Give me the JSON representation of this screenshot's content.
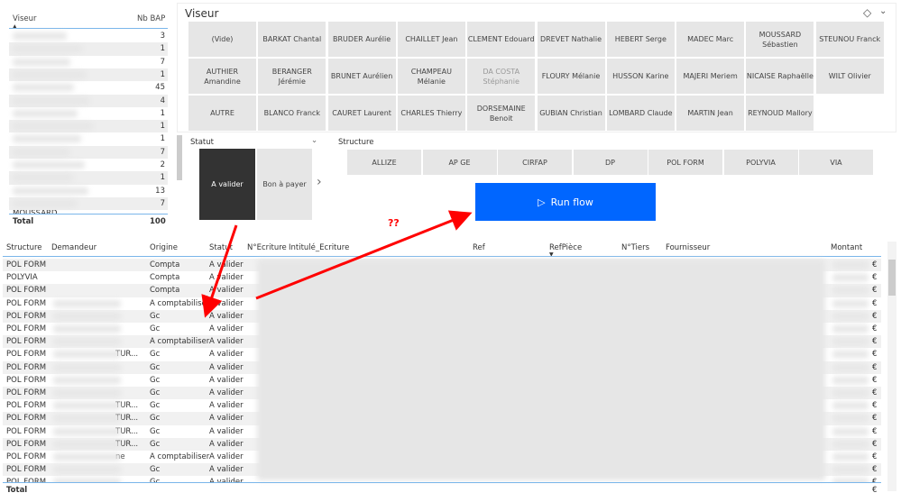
{
  "left_table": {
    "col_viseur": "Viseur",
    "col_nb": "Nb BAP",
    "values": [
      "3",
      "1",
      "7",
      "1",
      "45",
      "4",
      "1",
      "1",
      "1",
      "7",
      "2",
      "1",
      "13",
      "7"
    ],
    "partial_row": "MOUSSARD Sébastien",
    "total_label": "Total",
    "total_value": "100"
  },
  "viseur_slicer": {
    "title": "Viseur",
    "items": [
      "(Vide)",
      "BARKAT Chantal",
      "BRUDER Aurélie",
      "CHAILLET Jean",
      "CLEMENT Edouard",
      "DREVET Nathalie",
      "HEBERT Serge",
      "MADEC Marc",
      "MOUSSARD Sébastien",
      "STEUNOU Franck",
      "AUTHIER Amandine",
      "BERANGER Jérémie",
      "BRUNET Aurélien",
      "CHAMPEAU Mélanie",
      "DA COSTA Stéphanie",
      "FLOURY Mélanie",
      "HUSSON Karine",
      "MAJERI Meriem",
      "NICAISE Raphaëlle",
      "WILT Olivier",
      "AUTRE",
      "BLANCO Franck",
      "CAURET Laurent",
      "CHARLES Thierry",
      "DORSEMAINE Benoit",
      "GUBIAN Christian",
      "LOMBARD Claude",
      "MARTIN Jean",
      "REYNOUD Mallory"
    ]
  },
  "statut_slicer": {
    "title": "Statut",
    "items": [
      "A valider",
      "Bon à payer"
    ],
    "selected": "A valider"
  },
  "structure_slicer": {
    "title": "Structure",
    "items": [
      "ALLIZE",
      "AP GE",
      "CIRFAP",
      "DP",
      "POL FORM",
      "POLYVIA",
      "VIA"
    ]
  },
  "run_flow": {
    "label": "Run flow",
    "color": "#0066ff"
  },
  "annotation": {
    "text": "??",
    "color": "#ff0000"
  },
  "main_table": {
    "columns": [
      "Structure",
      "Demandeur",
      "Origine",
      "Statut",
      "N°Ecriture",
      "Intitulé_Ecriture",
      "Ref",
      "RefPièce",
      "N°Tiers",
      "Fournisseur",
      "Montant"
    ],
    "rows": [
      [
        "POL FORM",
        "",
        "Compta",
        "A valider"
      ],
      [
        "POLYVIA",
        "",
        "Compta",
        "A valider"
      ],
      [
        "POL FORM",
        "",
        "Compta",
        "A valider"
      ],
      [
        "POL FORM",
        "",
        "A comptabiliser",
        "A valider"
      ],
      [
        "POL FORM",
        "",
        "Gc",
        "A valider"
      ],
      [
        "POL FORM",
        "",
        "Gc",
        "A valider"
      ],
      [
        "POL FORM",
        "",
        "A comptabiliser",
        "A valider"
      ],
      [
        "POL FORM",
        "TUR...",
        "Gc",
        "A valider"
      ],
      [
        "POL FORM",
        "",
        "Gc",
        "A valider"
      ],
      [
        "POL FORM",
        "",
        "Gc",
        "A valider"
      ],
      [
        "POL FORM",
        "",
        "Gc",
        "A valider"
      ],
      [
        "POL FORM",
        "TUR...",
        "Gc",
        "A valider"
      ],
      [
        "POL FORM",
        "TUR...",
        "Gc",
        "A valider"
      ],
      [
        "POL FORM",
        "TUR...",
        "Gc",
        "A valider"
      ],
      [
        "POL FORM",
        "TUR...",
        "Gc",
        "A valider"
      ],
      [
        "POL FORM",
        "ne",
        "A comptabiliser",
        "A valider"
      ],
      [
        "POL FORM",
        "",
        "Gc",
        "A valider"
      ],
      [
        "POL FORM",
        "",
        "Gc",
        "A valider"
      ]
    ],
    "currency": "€",
    "total_label": "Total"
  }
}
